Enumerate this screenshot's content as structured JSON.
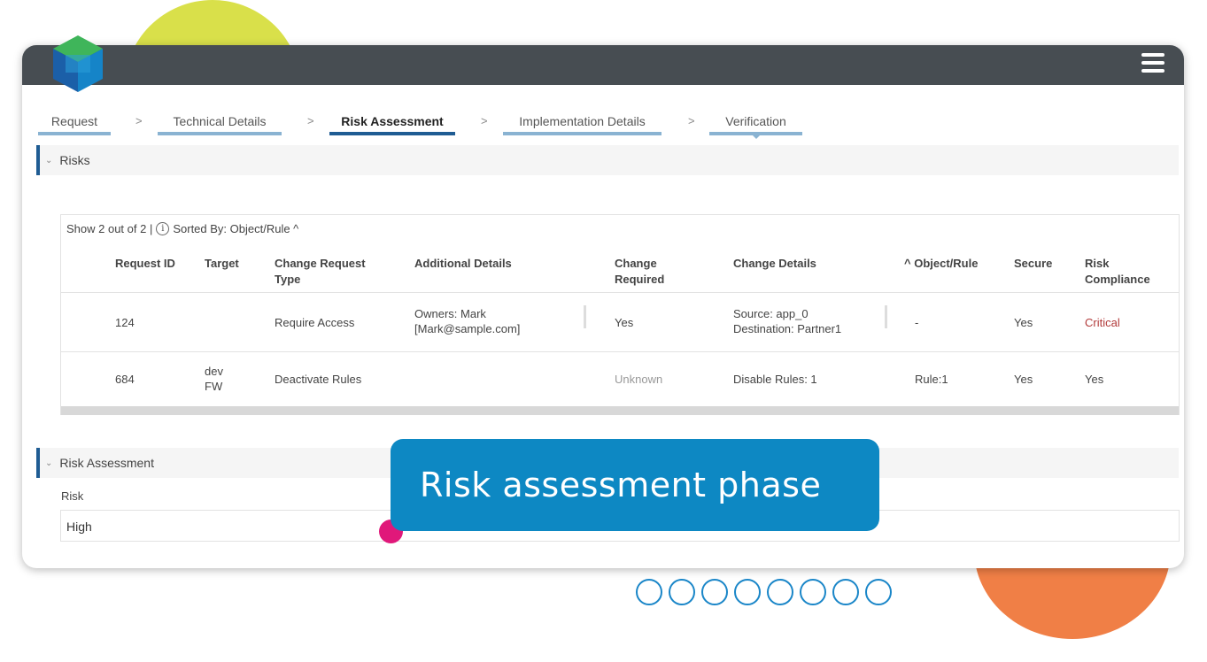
{
  "steps": [
    "Request",
    "Technical Details",
    "Risk Assessment",
    "Implementation Details",
    "Verification"
  ],
  "step_separator": ">",
  "risks_section": {
    "title": "Risks",
    "chevron": "⌄"
  },
  "grid": {
    "show_text": "Show 2 out of 2 |",
    "info_icon": "i",
    "sorted_by": "Sorted By:  Object/Rule ^",
    "headers": {
      "request_id": "Request ID",
      "target": "Target",
      "change_request_type": "Change Request Type",
      "additional_details": "Additional Details",
      "change_required": "Change Required",
      "change_details": "Change Details",
      "object_rule": "^ Object/Rule",
      "secure": "Secure",
      "risk_compliance": "Risk Compliance"
    },
    "rows": [
      {
        "request_id": "124",
        "target": "",
        "type": "Require Access",
        "details_line1": "Owners: Mark",
        "details_line2": "[Mark@sample.com]",
        "change_required": "Yes",
        "change_details_line1": "Source: app_0",
        "change_details_line2": "Destination: Partner1",
        "object_rule": "-",
        "secure": "Yes",
        "risk_compliance": "Critical"
      },
      {
        "request_id": "684",
        "target_line1": "dev",
        "target_line2": "FW",
        "type": "Deactivate Rules",
        "change_required": "Unknown",
        "change_details": "Disable Rules: 1",
        "object_rule": "Rule:1",
        "secure": "Yes",
        "risk_compliance": "Yes"
      }
    ]
  },
  "risk_assessment_section": {
    "title": "Risk Assessment",
    "chevron": "⌄"
  },
  "risk_field": {
    "label": "Risk",
    "value": "High"
  },
  "callout": {
    "text": "Risk assessment phase"
  },
  "colors": {
    "accent": "#1f5c93",
    "callout": "#0d88c3",
    "critical": "#b23b3b",
    "topbar": "#474d52"
  },
  "icons": {
    "menu": "hamburger-icon",
    "logo": "logo-icon",
    "info": "info-icon"
  }
}
